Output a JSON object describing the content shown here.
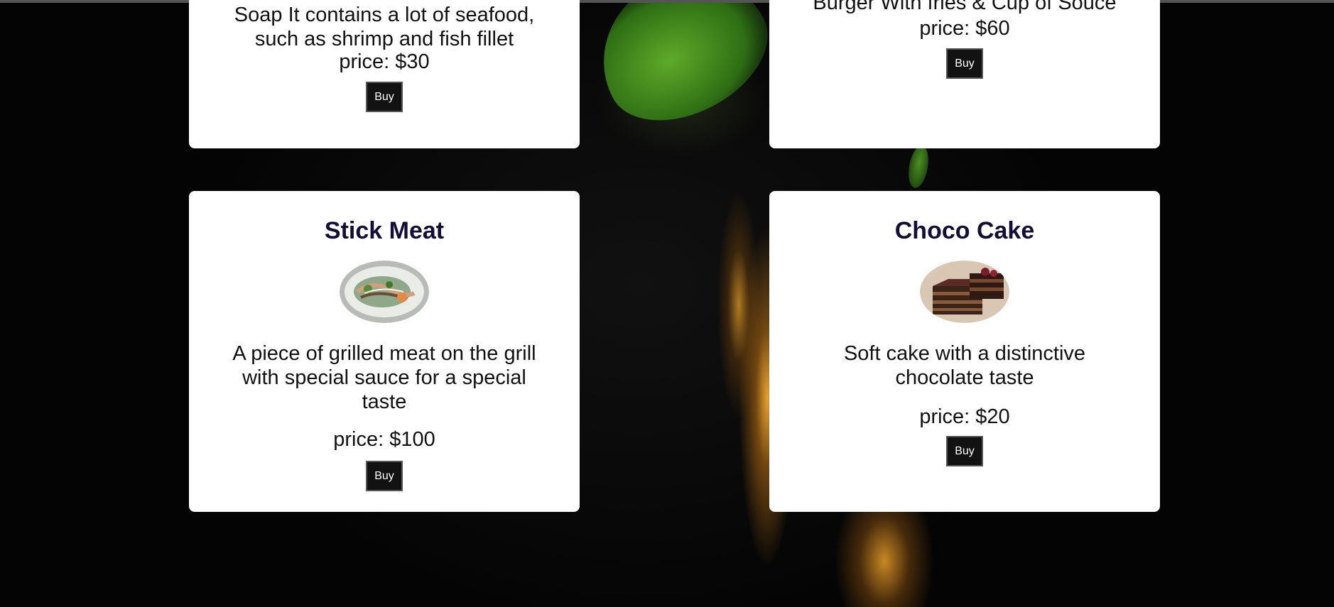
{
  "cards": [
    {
      "description": "Soap It contains a lot of seafood, such as shrimp and fish fillet",
      "price": "price: $30",
      "buy_label": "Buy"
    },
    {
      "description": "Burger With fries & Cup of Souce",
      "price": "price: $60",
      "buy_label": "Buy"
    },
    {
      "title": "Stick Meat",
      "description": "A piece of grilled meat on the grill with special sauce for a special taste",
      "price": "price: $100",
      "buy_label": "Buy"
    },
    {
      "title": "Choco Cake",
      "description": "Soft cake with a distinctive chocolate taste",
      "price": "price: $20",
      "buy_label": "Buy"
    }
  ],
  "colors": {
    "title": "#140d35",
    "button_bg": "#121212",
    "card_bg": "#ffffff",
    "page_bg": "#050505"
  },
  "icons": {
    "card3_image": "grilled-meat-plate-image",
    "card4_image": "chocolate-cake-image"
  }
}
